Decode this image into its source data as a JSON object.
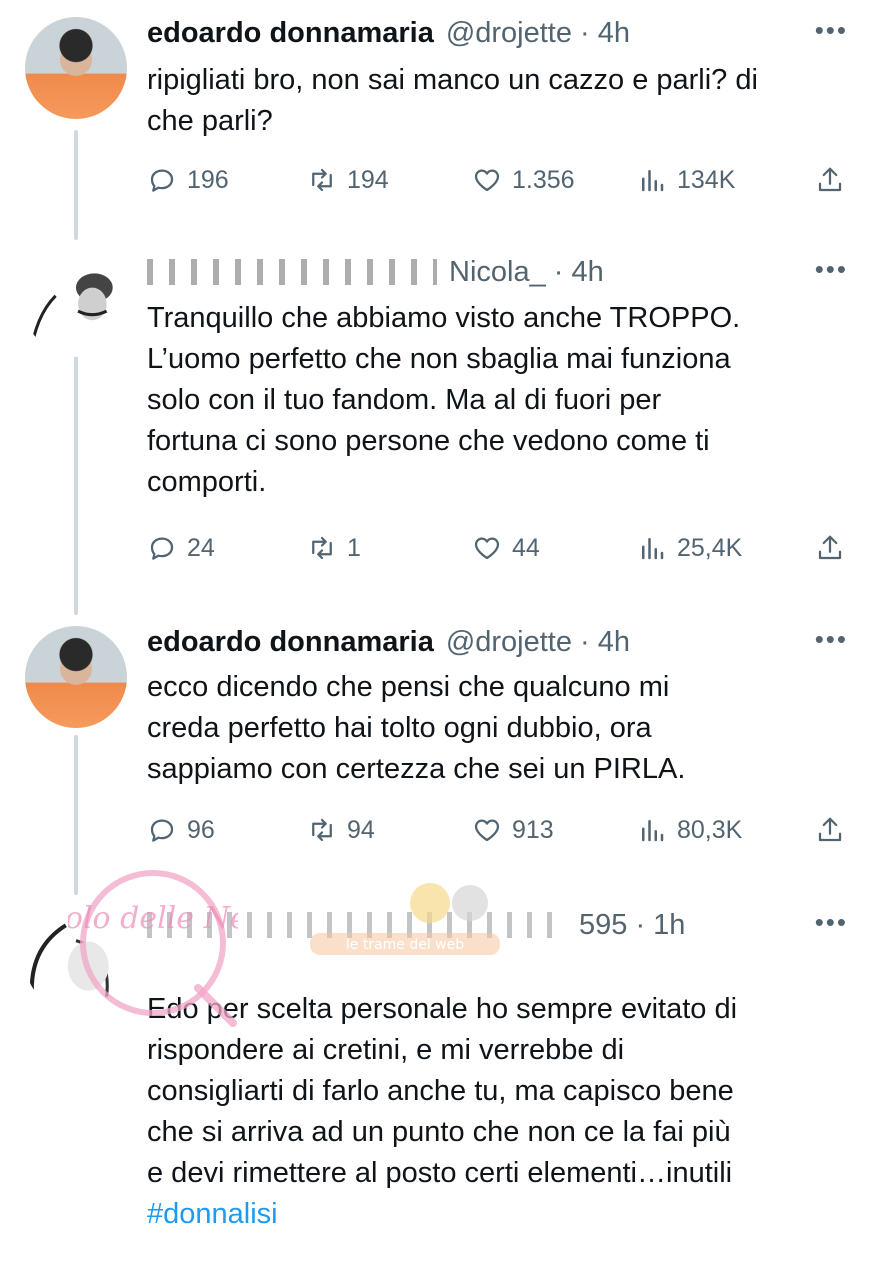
{
  "tweets": [
    {
      "name": "edoardo donnamaria",
      "handle": "@drojette · 4h",
      "text": "ripigliati bro, non sai manco un cazzo e parli? di\nche parli?",
      "replies": "196",
      "retweets": "194",
      "likes": "1.356",
      "views": "134K"
    },
    {
      "name": "",
      "handle": "Nicola_ · 4h",
      "text": "Tranquillo che abbiamo visto anche TROPPO.\nL’uomo perfetto che non sbaglia mai funziona\nsolo con il tuo fandom. Ma al di fuori per\nfortuna ci sono persone che vedono come ti\ncomporti.",
      "replies": "24",
      "retweets": "1",
      "likes": "44",
      "views": "25,4K"
    },
    {
      "name": "edoardo donnamaria",
      "handle": "@drojette · 4h",
      "text": "ecco dicendo che pensi che qualcuno mi\ncreda perfetto hai tolto ogni dubbio, ora\nsappiamo con certezza che sei un PIRLA.",
      "replies": "96",
      "retweets": "94",
      "likes": "913",
      "views": "80,3K"
    },
    {
      "name": "",
      "handle": "595 · 1h",
      "text": "Edo per scelta personale ho sempre evitato di\nrispondere ai cretini, e mi verrebbe di\nconsigliarti di farlo anche tu, ma capisco bene\nche si arriva ad un punto che non ce la fai più\ne devi rimettere al posto certi elementi…inutili",
      "hashtag": "#donnalisi"
    }
  ],
  "watermark": {
    "text": "Vicolo delle News",
    "subtext": "le trame del web"
  },
  "icons": {
    "reply": "reply-icon",
    "retweet": "retweet-icon",
    "like": "heart-icon",
    "views": "views-icon",
    "share": "share-icon",
    "more": "more-icon"
  },
  "colors": {
    "text": "#0f1419",
    "secondary": "#536471",
    "link": "#1d9bf0",
    "thread_line": "#cfd9de"
  }
}
